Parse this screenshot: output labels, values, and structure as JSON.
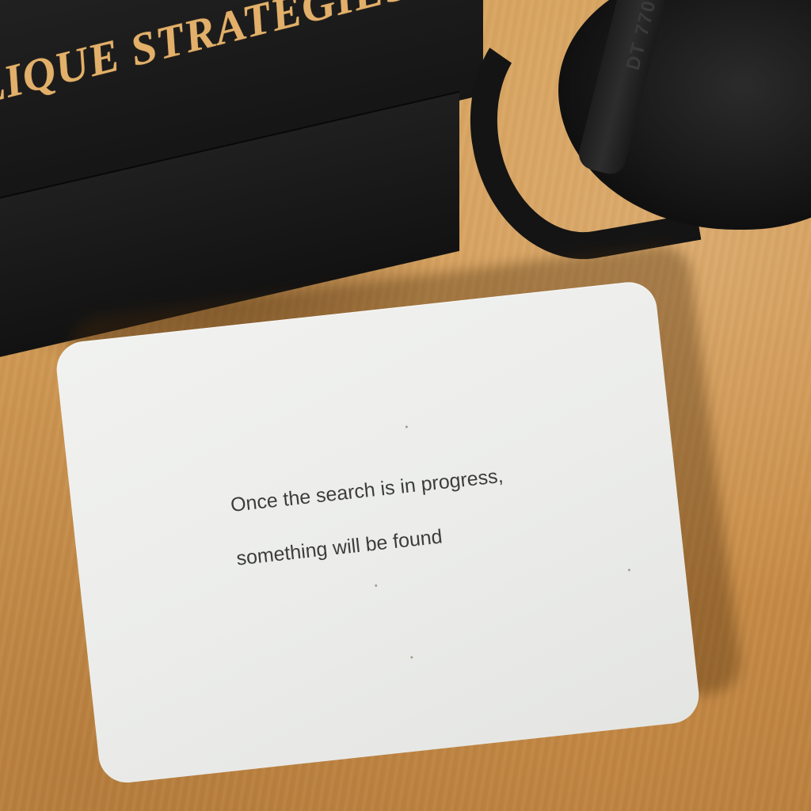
{
  "box": {
    "label": "BLIQUE STRATEGIES"
  },
  "headphones": {
    "brand": "DT 770"
  },
  "card": {
    "line1": "Once the search is in progress,",
    "line2": "something will be found"
  }
}
